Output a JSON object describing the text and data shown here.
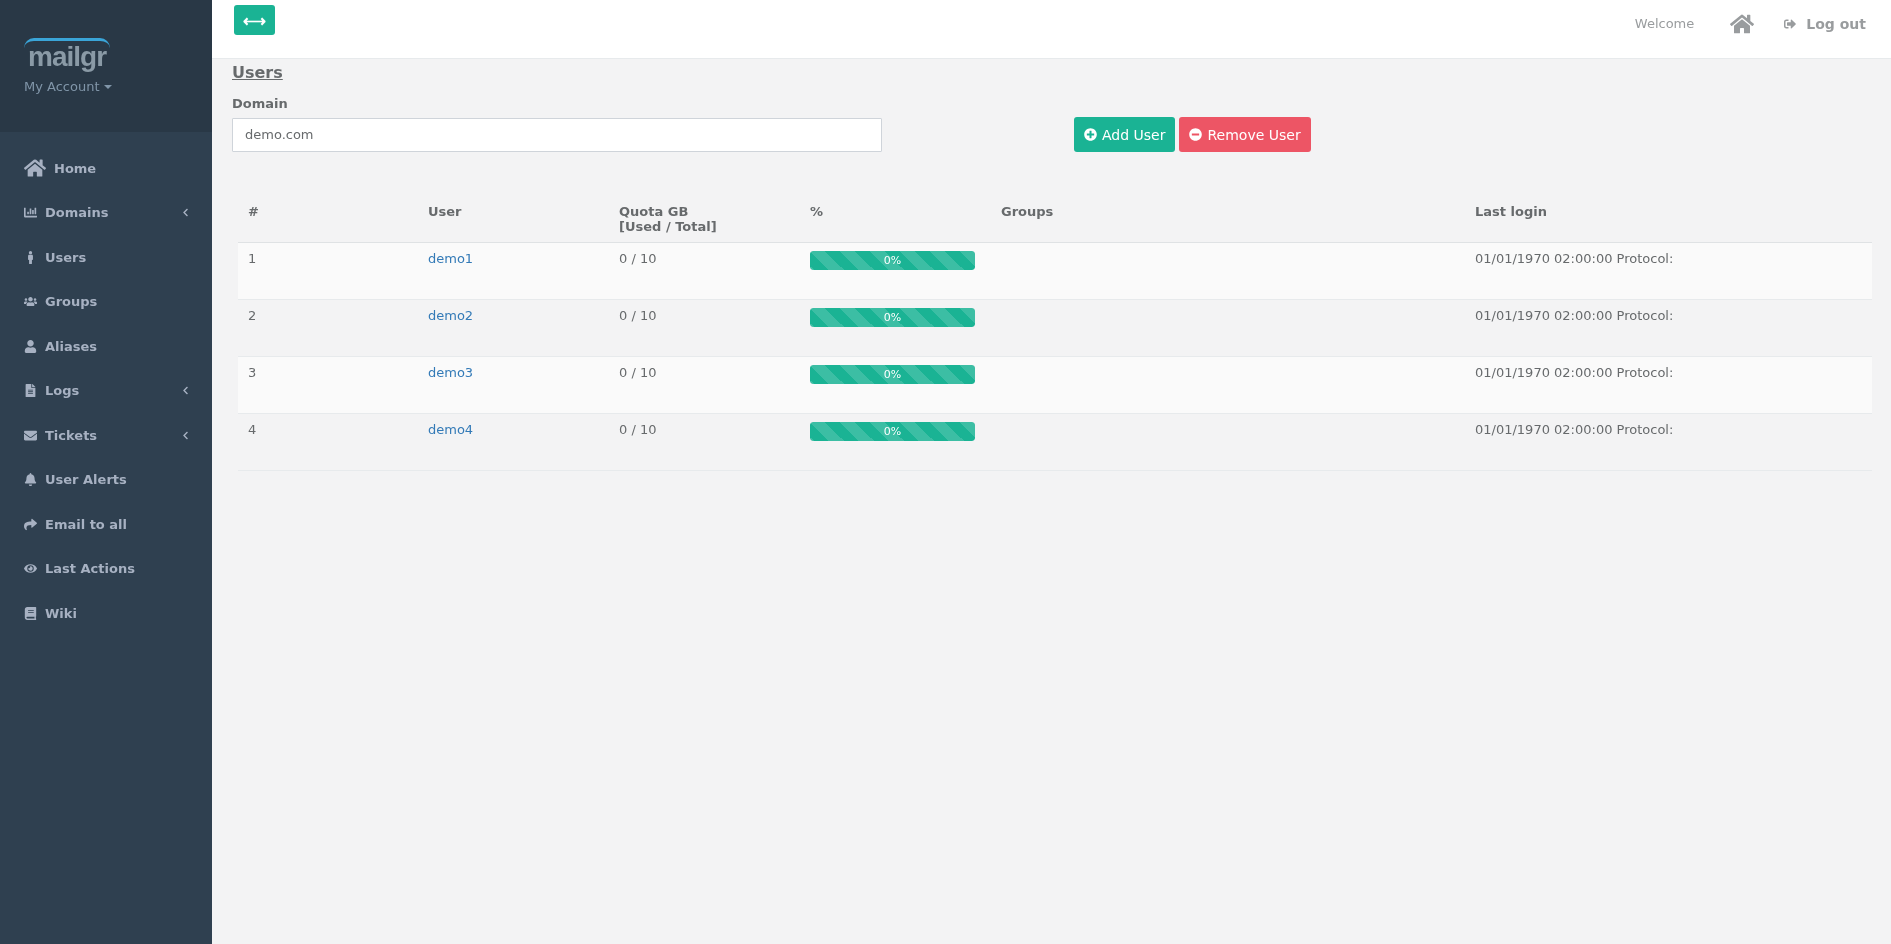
{
  "sidebar": {
    "logo": "mailgr",
    "account": "My Account",
    "items": [
      {
        "label": "Home",
        "submenu": false
      },
      {
        "label": "Domains",
        "submenu": true
      },
      {
        "label": "Users",
        "submenu": false
      },
      {
        "label": "Groups",
        "submenu": false
      },
      {
        "label": "Aliases",
        "submenu": false
      },
      {
        "label": "Logs",
        "submenu": true
      },
      {
        "label": "Tickets",
        "submenu": true
      },
      {
        "label": "User Alerts",
        "submenu": false
      },
      {
        "label": "Email to all",
        "submenu": false
      },
      {
        "label": "Last Actions",
        "submenu": false
      },
      {
        "label": "Wiki",
        "submenu": false
      }
    ]
  },
  "header": {
    "toggle": "⟷",
    "welcome": "Welcome",
    "logout": "Log out"
  },
  "page": {
    "title": "Users",
    "domain_label": "Domain",
    "domain_value": "demo.com",
    "buttons": [
      {
        "label": "Add User",
        "kind": "add"
      },
      {
        "label": "Remove User",
        "kind": "remove"
      }
    ]
  },
  "table": {
    "columns": [
      "#",
      "User",
      "Quota GB\n[Used / Total]",
      "%",
      "Groups",
      "Last login"
    ],
    "rows": [
      {
        "num": "1",
        "user": "demo1",
        "quota": "0 / 10",
        "percent": "0%",
        "level": 1,
        "last_login": "01/01/1970 02:00:00 Protocol:"
      },
      {
        "num": "2",
        "user": "demo2",
        "quota": "0 / 10",
        "percent": "0%",
        "level": 1,
        "last_login": "01/01/1970 02:00:00 Protocol:"
      },
      {
        "num": "3",
        "user": "demo3",
        "quota": "0 / 10",
        "percent": "0%",
        "level": 1,
        "last_login": "01/01/1970 02:00:00 Protocol:"
      },
      {
        "num": "4",
        "user": "demo4",
        "quota": "0 / 10",
        "percent": "0%",
        "level": 1,
        "last_login": "01/01/1970 02:00:00 Protocol:"
      }
    ]
  }
}
